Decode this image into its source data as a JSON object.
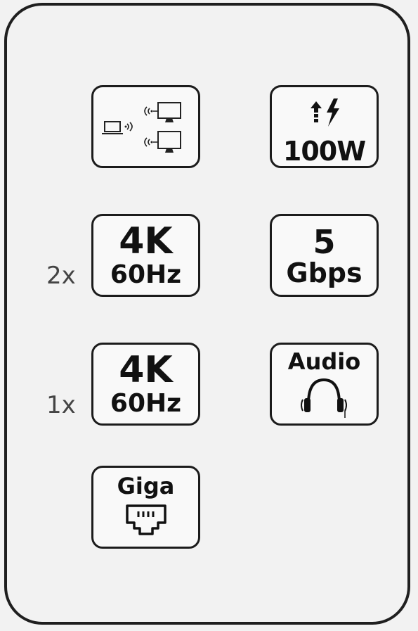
{
  "badges": {
    "display": {
      "icon": "laptop-to-dual-monitor-icon"
    },
    "power": {
      "value": "100W",
      "icon": "up-arrow-lightning-icon"
    },
    "video_dual": {
      "multiplier": "2x",
      "resolution": "4K",
      "refresh": "60Hz"
    },
    "speed": {
      "value": "5",
      "unit": "Gbps"
    },
    "video_single": {
      "multiplier": "1x",
      "resolution": "4K",
      "refresh": "60Hz"
    },
    "audio": {
      "label": "Audio",
      "icon": "headphones-icon"
    },
    "ethernet": {
      "label": "Giga",
      "icon": "ethernet-port-icon"
    }
  }
}
